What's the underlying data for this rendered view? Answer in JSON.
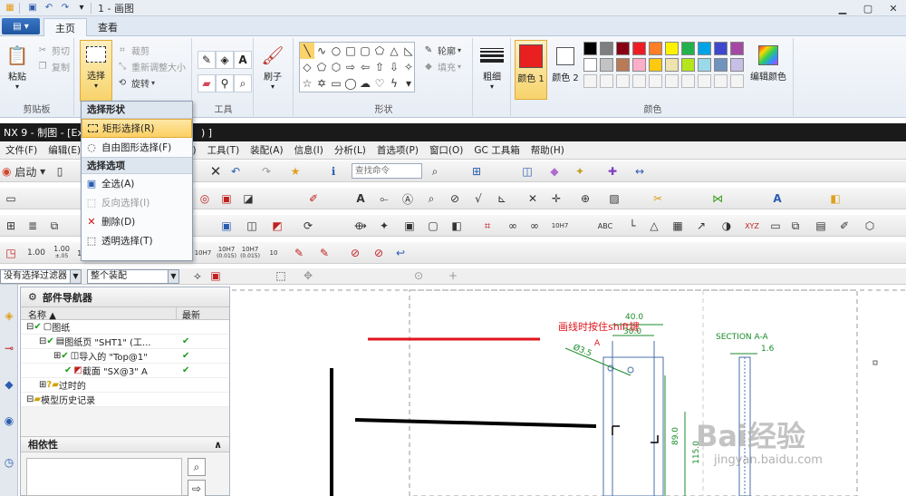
{
  "titlebar": {
    "title": "1 - 画图"
  },
  "tabs": [
    {
      "label": "主页",
      "active": true
    },
    {
      "label": "查看",
      "active": false
    }
  ],
  "ribbon": {
    "clipboard": {
      "paste_label": "粘贴",
      "cut_label": "剪切",
      "copy_label": "复制",
      "group_label": "剪贴板"
    },
    "image": {
      "select_label": "选择",
      "crop_label": "裁剪",
      "resize_label": "重新调整大小",
      "rotate_label": "旋转"
    },
    "tools": {
      "group_label": "工具"
    },
    "brushes": {
      "label": "刷子"
    },
    "shapes": {
      "outline_label": "轮廓",
      "fill_label": "填充",
      "group_label": "形状"
    },
    "size": {
      "label": "粗细"
    },
    "colors": {
      "color1_label": "颜色 1",
      "color2_label": "颜色 2",
      "edit_label": "编辑颜色",
      "group_label": "颜色",
      "color1": "#e8201f",
      "color2": "#ffffff",
      "palette_row1": [
        "#000000",
        "#7f7f7f",
        "#880015",
        "#ed1c24",
        "#ff7f27",
        "#fff200",
        "#22b14c",
        "#00a2e8",
        "#3f48cc",
        "#a349a4"
      ],
      "palette_row2": [
        "#ffffff",
        "#c3c3c3",
        "#b97a57",
        "#ffaec9",
        "#ffc90e",
        "#efe4b0",
        "#b5e61d",
        "#99d9ea",
        "#7092be",
        "#c8bfe7"
      ]
    }
  },
  "select_menu": {
    "header1": "选择形状",
    "items1": [
      {
        "label": "矩形选择(R)",
        "highlighted": true,
        "disabled": false
      },
      {
        "label": "自由图形选择(F)",
        "highlighted": false,
        "disabled": false
      }
    ],
    "header2": "选择选项",
    "items2": [
      {
        "label": "全选(A)",
        "disabled": false
      },
      {
        "label": "反向选择(I)",
        "disabled": true
      },
      {
        "label": "删除(D)",
        "disabled": false
      },
      {
        "label": "透明选择(T)",
        "disabled": false
      }
    ]
  },
  "nx": {
    "title": "NX 9 - 制图 - [Ex",
    "title_tail": ")  ]",
    "menu": [
      "文件(F)",
      "编辑(E)",
      "工具(T)",
      "装配(A)",
      "信息(I)",
      "分析(L)",
      "首选项(P)",
      "窗口(O)",
      "GC 工具箱",
      "帮助(H)"
    ],
    "menu_partial": "(R)",
    "start_label": "启动",
    "search_placeholder": "查找命令",
    "filter_text": "没有选择过滤器",
    "assembly_text": "整个装配",
    "toolbar_values": [
      "1.00",
      "1.00",
      "1.00",
      "10H7",
      "10H7",
      "10H7",
      "10"
    ],
    "tol_texts": [
      "±.05",
      "(0.015)",
      "(0.015)"
    ],
    "abc_label": "ABC",
    "xyz_label": "XYZ"
  },
  "navigator": {
    "title": "部件导航器",
    "col_name": "名称",
    "col_latest": "最新",
    "rows": [
      {
        "label": "图纸",
        "latest": false,
        "indent": 0
      },
      {
        "label": "图纸页 \"SHT1\" (工...",
        "latest": true,
        "indent": 1
      },
      {
        "label": "导入的 \"Top@1\"",
        "latest": true,
        "indent": 2
      },
      {
        "label": "截面 \"SX@3\" A",
        "latest": true,
        "indent": 2
      },
      {
        "label": "过时的",
        "latest": false,
        "indent": 1
      },
      {
        "label": "模型历史记录",
        "latest": false,
        "indent": 0
      }
    ],
    "dep_title": "相依性"
  },
  "drawing": {
    "annotation": "画线时按住shift键",
    "section_label": "SECTION A-A",
    "dims": [
      "40.0",
      "30.0",
      "Ø3.5",
      "1.6",
      "89.0",
      "115.0",
      "A"
    ],
    "watermark": "Bai经验",
    "watermark_url": "jingyan.baidu.com",
    "colors": {
      "red": "#e0141e",
      "green": "#1a8c2a",
      "blue": "#4b6fa8"
    }
  }
}
